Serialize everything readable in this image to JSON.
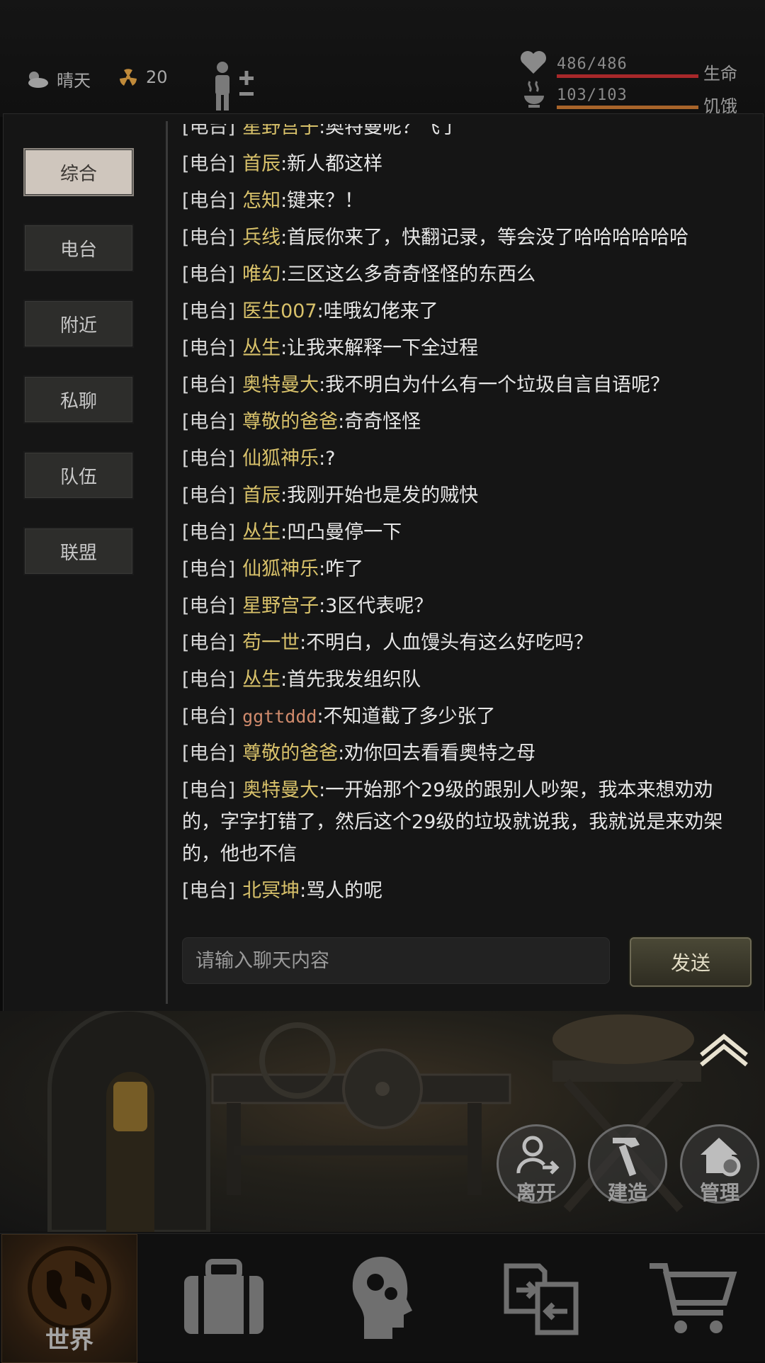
{
  "status": {
    "weather": "晴天",
    "radiation": "20",
    "health_value": "486/486",
    "health_label": "生命",
    "health_fill": 1.0,
    "hunger_value": "103/103",
    "hunger_label": "饥饿",
    "hunger_fill": 1.0,
    "health_color": "#a8282a",
    "hunger_color": "#a8642a"
  },
  "tabs": [
    {
      "label": "综合",
      "active": true
    },
    {
      "label": "电台",
      "active": false
    },
    {
      "label": "附近",
      "active": false
    },
    {
      "label": "私聊",
      "active": false
    },
    {
      "label": "队伍",
      "active": false
    },
    {
      "label": "联盟",
      "active": false
    }
  ],
  "messages": [
    {
      "channel": "[电台]",
      "name": "星野宫子",
      "text": ":奥特曼呢？飞了"
    },
    {
      "channel": "[电台]",
      "name": "首辰",
      "text": ":新人都这样"
    },
    {
      "channel": "[电台]",
      "name": "怎知",
      "text": ":键来？！"
    },
    {
      "channel": "[电台]",
      "name": "兵线",
      "text": ":首辰你来了，快翻记录，等会没了哈哈哈哈哈哈"
    },
    {
      "channel": "[电台]",
      "name": "唯幻",
      "text": ":三区这么多奇奇怪怪的东西么"
    },
    {
      "channel": "[电台]",
      "name": "医生007",
      "text": ":哇哦幻佬来了"
    },
    {
      "channel": "[电台]",
      "name": "丛生",
      "text": ":让我来解释一下全过程"
    },
    {
      "channel": "[电台]",
      "name": "奥特曼大",
      "text": ":我不明白为什么有一个垃圾自言自语呢？"
    },
    {
      "channel": "[电台]",
      "name": "尊敬的爸爸",
      "text": ":奇奇怪怪"
    },
    {
      "channel": "[电台]",
      "name": "仙狐神乐",
      "text": ":?"
    },
    {
      "channel": "[电台]",
      "name": "首辰",
      "text": ":我刚开始也是发的贼快"
    },
    {
      "channel": "[电台]",
      "name": "丛生",
      "text": ":凹凸曼停一下"
    },
    {
      "channel": "[电台]",
      "name": "仙狐神乐",
      "text": ":咋了"
    },
    {
      "channel": "[电台]",
      "name": "星野宫子",
      "text": ":3区代表呢？"
    },
    {
      "channel": "[电台]",
      "name": "苟一世",
      "text": ":不明白，人血馒头有这么好吃吗？"
    },
    {
      "channel": "[电台]",
      "name": "丛生",
      "text": ":首先我发组织队"
    },
    {
      "channel": "[电台]",
      "name": "ggttddd",
      "text": ":不知道截了多少张了",
      "alt": true
    },
    {
      "channel": "[电台]",
      "name": "尊敬的爸爸",
      "text": ":劝你回去看看奥特之母"
    },
    {
      "channel": "[电台]",
      "name": "奥特曼大",
      "text": ":一开始那个29级的跟别人吵架，我本来想劝劝的，字字打错了，然后这个29级的垃圾就说我，我就说是来劝架的，他也不信"
    },
    {
      "channel": "[电台]",
      "name": "北冥坤",
      "text": ":骂人的呢"
    }
  ],
  "input": {
    "placeholder": "请输入聊天内容",
    "value": ""
  },
  "send_label": "发送",
  "actions": [
    {
      "label": "离开",
      "icon": "leave-icon"
    },
    {
      "label": "建造",
      "icon": "hammer-icon"
    },
    {
      "label": "管理",
      "icon": "house-gear-icon"
    }
  ],
  "nav": [
    {
      "label": "世界",
      "icon": "globe-icon",
      "active": true
    },
    {
      "label": "",
      "icon": "suitcase-icon"
    },
    {
      "label": "",
      "icon": "head-gear-icon"
    },
    {
      "label": "",
      "icon": "swap-icon"
    },
    {
      "label": "",
      "icon": "cart-icon"
    }
  ]
}
